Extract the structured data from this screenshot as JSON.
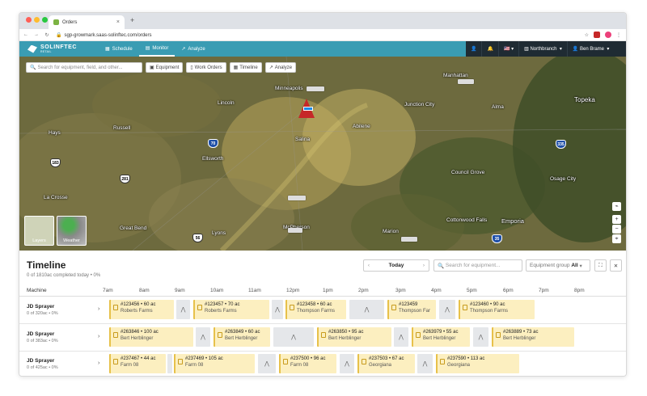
{
  "browser": {
    "tab_title": "Orders",
    "url": "sgp-growmark.saas-solinftec.com/orders"
  },
  "appbar": {
    "brand": "SOLINFTEC",
    "brand_sub": "RETAIL",
    "nav": [
      {
        "label": "Schedule",
        "icon": "calendar-icon"
      },
      {
        "label": "Monitor",
        "icon": "map-icon",
        "active": true
      },
      {
        "label": "Analyze",
        "icon": "chart-icon"
      }
    ],
    "branch": "Northbranch",
    "user": "Ben Brame"
  },
  "map": {
    "search_placeholder": "Search for equipment, field, and other...",
    "buttons": [
      "Equipment",
      "Work Orders",
      "Timeline",
      "Analyze"
    ],
    "cities": [
      "Minneapolis",
      "Lincoln",
      "Salina",
      "Abilene",
      "Manhattan",
      "Junction City",
      "Alma",
      "Topeka",
      "Hays",
      "Russell",
      "Ellsworth",
      "Council Grove",
      "Osage City",
      "La Crosse",
      "Great Bend",
      "Lyons",
      "Marion",
      "Cottonwood Falls",
      "Emporia",
      "McPherson"
    ],
    "highways": [
      "70",
      "183",
      "281",
      "335",
      "35",
      "56"
    ],
    "layers_label": "Layers",
    "weather_label": "Weather"
  },
  "timeline": {
    "title": "Timeline",
    "subtitle": "0 of 1810ac completed today • 0%",
    "date_label": "Today",
    "search_placeholder": "Search for equipment...",
    "group_label": "Equipment group",
    "group_value": "All",
    "machine_header": "Machine",
    "hours": [
      "7am",
      "8am",
      "9am",
      "10am",
      "11am",
      "12pm",
      "1pm",
      "2pm",
      "3pm",
      "4pm",
      "5pm",
      "6pm",
      "7pm",
      "8pm"
    ],
    "rows": [
      {
        "name": "JD Sprayer",
        "sub": "0 of 320ac • 0%",
        "jobs": [
          {
            "id": "#123456 • 60 ac",
            "farm": "Roberts Farms"
          },
          {
            "id": "#123457 • 70 ac",
            "farm": "Roberts Farms"
          },
          {
            "id": "#123458 • 60 ac",
            "farm": "Thompson Farms"
          },
          {
            "id": "#123459",
            "farm": "Thompson Far"
          },
          {
            "id": "#123460 • 90 ac",
            "farm": "Thompson Farms"
          }
        ]
      },
      {
        "name": "JD Sprayer",
        "sub": "0 of 383ac • 0%",
        "jobs": [
          {
            "id": "#263846 • 100 ac",
            "farm": "Bert Herblinger"
          },
          {
            "id": "#263849 • 60 ac",
            "farm": "Bert Herblinger"
          },
          {
            "id": "#263850 • 95 ac",
            "farm": "Bert Herblinger"
          },
          {
            "id": "#263979 • 55 ac",
            "farm": "Bert Herblinger"
          },
          {
            "id": "#263889 • 73 ac",
            "farm": "Bert Herblinger"
          }
        ]
      },
      {
        "name": "JD Sprayer",
        "sub": "0 of 425ac • 0%",
        "jobs": [
          {
            "id": "#237467 • 44 ac",
            "farm": "Farm 08"
          },
          {
            "id": "#237469 • 105 ac",
            "farm": "Farm 08"
          },
          {
            "id": "#237500 • 96 ac",
            "farm": "Farm 08"
          },
          {
            "id": "#237503 • 67 ac",
            "farm": "Georgiana"
          },
          {
            "id": "#237590 • 113 ac",
            "farm": "Georgiana"
          }
        ]
      }
    ]
  }
}
